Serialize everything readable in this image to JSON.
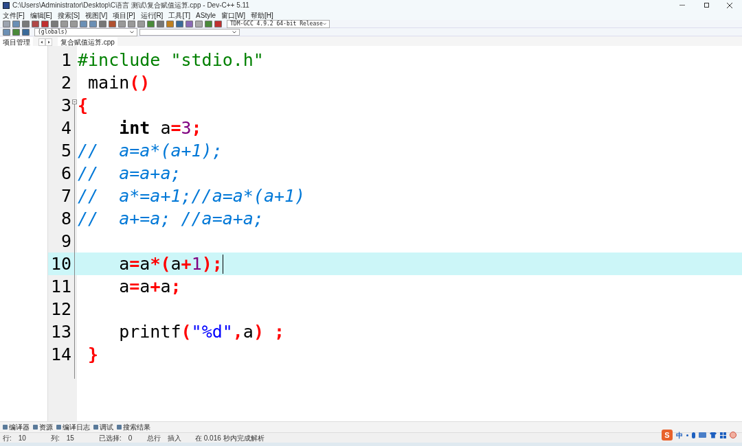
{
  "window": {
    "title": "C:\\Users\\Administrator\\Desktop\\C语言 测试\\复合赋值运算.cpp - Dev-C++ 5.11"
  },
  "menu": [
    "文件[F]",
    "编辑[E]",
    "搜索[S]",
    "视图[V]",
    "项目[P]",
    "运行[R]",
    "工具[T]",
    "AStyle",
    "窗口[W]",
    "帮助[H]"
  ],
  "toolbar": {
    "compiler": "TDM-GCC 4.9.2 64-bit Release",
    "scope": "(globals)"
  },
  "side_panel": {
    "tab": "项目管理"
  },
  "editor_tabs": [
    {
      "label": "复合赋值运算.cpp",
      "selected": true
    }
  ],
  "code_lines": [
    {
      "number": "1",
      "current": false,
      "tokens": [
        {
          "text": "#include \"stdio.h\"",
          "kind": "preproc"
        }
      ]
    },
    {
      "number": "2",
      "current": false,
      "tokens": [
        {
          "text": " main",
          "kind": "plain"
        },
        {
          "text": "()",
          "kind": "symbol"
        }
      ]
    },
    {
      "number": "3",
      "current": false,
      "fold": true,
      "tokens": [
        {
          "text": "{",
          "kind": "symbol"
        }
      ]
    },
    {
      "number": "4",
      "current": false,
      "tokens": [
        {
          "text": "    int",
          "kind": "keyword"
        },
        {
          "text": " a",
          "kind": "plain"
        },
        {
          "text": "=",
          "kind": "symbol"
        },
        {
          "text": "3",
          "kind": "number"
        },
        {
          "text": ";",
          "kind": "symbol"
        }
      ]
    },
    {
      "number": "5",
      "current": false,
      "tokens": [
        {
          "text": "//  a=a*(a+1);",
          "kind": "comment"
        }
      ]
    },
    {
      "number": "6",
      "current": false,
      "tokens": [
        {
          "text": "//  a=a+a;",
          "kind": "comment"
        }
      ]
    },
    {
      "number": "7",
      "current": false,
      "tokens": [
        {
          "text": "//  a*=a+1;//a=a*(a+1)",
          "kind": "comment"
        }
      ]
    },
    {
      "number": "8",
      "current": false,
      "tokens": [
        {
          "text": "//  a+=a; //a=a+a;",
          "kind": "comment"
        }
      ]
    },
    {
      "number": "9",
      "current": false
    },
    {
      "number": "10",
      "current": true,
      "tokens": [
        {
          "text": "    a",
          "kind": "plain"
        },
        {
          "text": "=",
          "kind": "symbol"
        },
        {
          "text": "a",
          "kind": "plain"
        },
        {
          "text": "*(",
          "kind": "symbol"
        },
        {
          "text": "a",
          "kind": "plain"
        },
        {
          "text": "+",
          "kind": "symbol"
        },
        {
          "text": "1",
          "kind": "number"
        },
        {
          "text": ");",
          "kind": "symbol"
        }
      ]
    },
    {
      "number": "11",
      "current": false,
      "tokens": [
        {
          "text": "    a",
          "kind": "plain"
        },
        {
          "text": "=",
          "kind": "symbol"
        },
        {
          "text": "a",
          "kind": "plain"
        },
        {
          "text": "+",
          "kind": "symbol"
        },
        {
          "text": "a",
          "kind": "plain"
        },
        {
          "text": ";",
          "kind": "symbol"
        }
      ]
    },
    {
      "number": "12",
      "current": false
    },
    {
      "number": "13",
      "current": false,
      "tokens": [
        {
          "text": "    printf",
          "kind": "plain"
        },
        {
          "text": "(",
          "kind": "symbol"
        },
        {
          "text": "\"%d\"",
          "kind": "string"
        },
        {
          "text": ",",
          "kind": "symbol"
        },
        {
          "text": "a",
          "kind": "plain"
        },
        {
          "text": ") ;",
          "kind": "symbol"
        }
      ]
    },
    {
      "number": "14",
      "current": false,
      "tokens": [
        {
          "text": " }",
          "kind": "symbol"
        }
      ]
    }
  ],
  "bottom_tabs": [
    "编译器",
    "资源",
    "编译日志",
    "调试",
    "搜索结果"
  ],
  "status_bar": [
    {
      "label": "行:",
      "value": "10"
    },
    {
      "label": "列:",
      "value": "15"
    },
    {
      "label": "已选择:",
      "value": "0"
    },
    {
      "label": "总行",
      "value": "插入"
    },
    {
      "value": "在 0.016 秒内完成解析"
    }
  ],
  "ime_tray": {
    "logo": "S",
    "mode": "中"
  }
}
